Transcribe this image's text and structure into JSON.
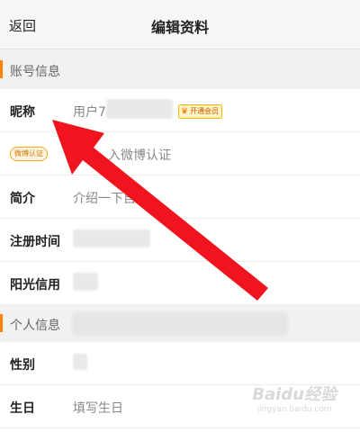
{
  "header": {
    "back_label": "返回",
    "title": "编辑资料"
  },
  "sections": {
    "account": {
      "title": "账号信息"
    },
    "personal": {
      "title": "个人信息"
    }
  },
  "rows": {
    "nickname": {
      "label": "昵称",
      "value": "用户7",
      "badge": "开通会员"
    },
    "verify": {
      "badge": "微博认证",
      "value": "入微博认证"
    },
    "intro": {
      "label": "简介",
      "value": "介绍一下自己"
    },
    "register": {
      "label": "注册时间"
    },
    "credit": {
      "label": "阳光信用"
    },
    "gender": {
      "label": "性别"
    },
    "birthday": {
      "label": "生日",
      "value": "填写生日"
    }
  },
  "watermark": {
    "brand": "Baidu经验",
    "url": "jingyan.baidu.com"
  },
  "colors": {
    "accent": "#ff8200",
    "arrow": "#f0141e"
  }
}
